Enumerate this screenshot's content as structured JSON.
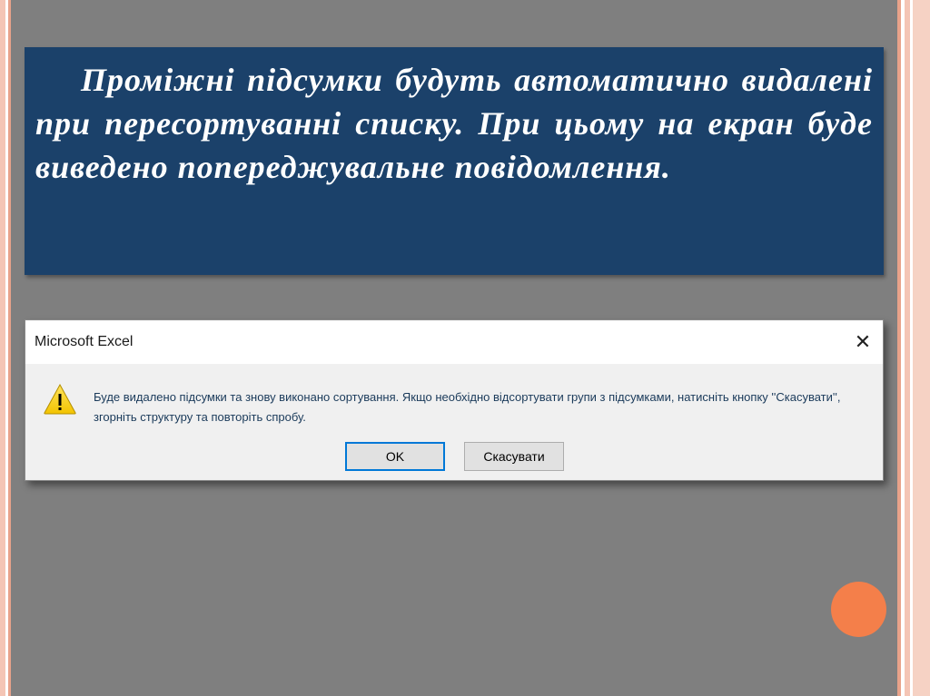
{
  "slide": {
    "paragraph": "Проміжні підсумки будуть автоматично видалені при пересортуванні списку. При цьому на екран буде виведено попереджувальне повідомлення."
  },
  "dialog": {
    "title": "Microsoft Excel",
    "close_icon": "close-icon",
    "warning_icon": "warning-icon",
    "message_line1": "Буде видалено підсумки та знову виконано сортування. Якщо необхідно відсортувати групи з підсумками, натисніть кнопку ''Скасувати'',",
    "message_line2": "згорніть структуру та повторіть спробу.",
    "ok_label": "OK",
    "cancel_label": "Скасувати"
  },
  "colors": {
    "panel_bg": "#1b416a",
    "slide_bg": "#7f7f7f",
    "accent_circle": "#f47f4a",
    "default_button_border": "#0078d7"
  }
}
